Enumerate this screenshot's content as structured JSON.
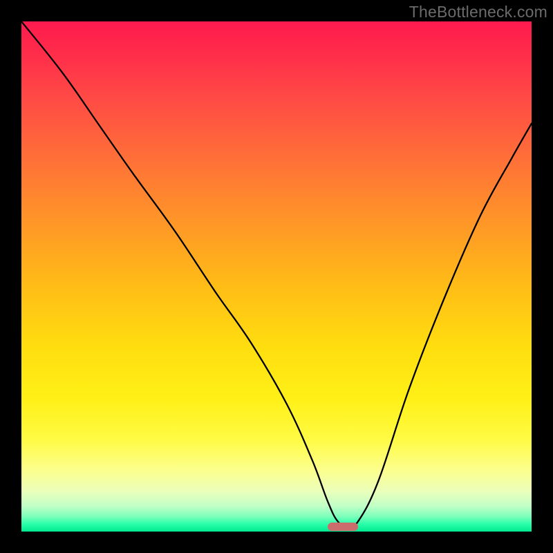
{
  "watermark": "TheBottleneck.com",
  "chart_data": {
    "type": "line",
    "title": "",
    "xlabel": "",
    "ylabel": "",
    "xlim": [
      0,
      100
    ],
    "ylim": [
      0,
      100
    ],
    "grid": false,
    "legend": false,
    "series": [
      {
        "name": "bottleneck-curve",
        "x": [
          0,
          8,
          15,
          22,
          30,
          38,
          45,
          52,
          57,
          60,
          62,
          64,
          66,
          70,
          76,
          83,
          90,
          96,
          100
        ],
        "values": [
          100,
          90,
          80,
          70,
          59,
          47,
          37,
          25,
          14,
          6,
          2,
          1,
          2,
          10,
          28,
          46,
          62,
          73,
          80
        ]
      }
    ],
    "marker": {
      "x_start": 60,
      "x_end": 66,
      "y": 1,
      "color": "#cb6d6d"
    }
  },
  "colors": {
    "background": "#000000",
    "gradient_top": "#ff1a4e",
    "gradient_bottom": "#00e98f",
    "curve": "#000000",
    "marker": "#cb6d6d",
    "watermark": "#6b6b6b"
  }
}
